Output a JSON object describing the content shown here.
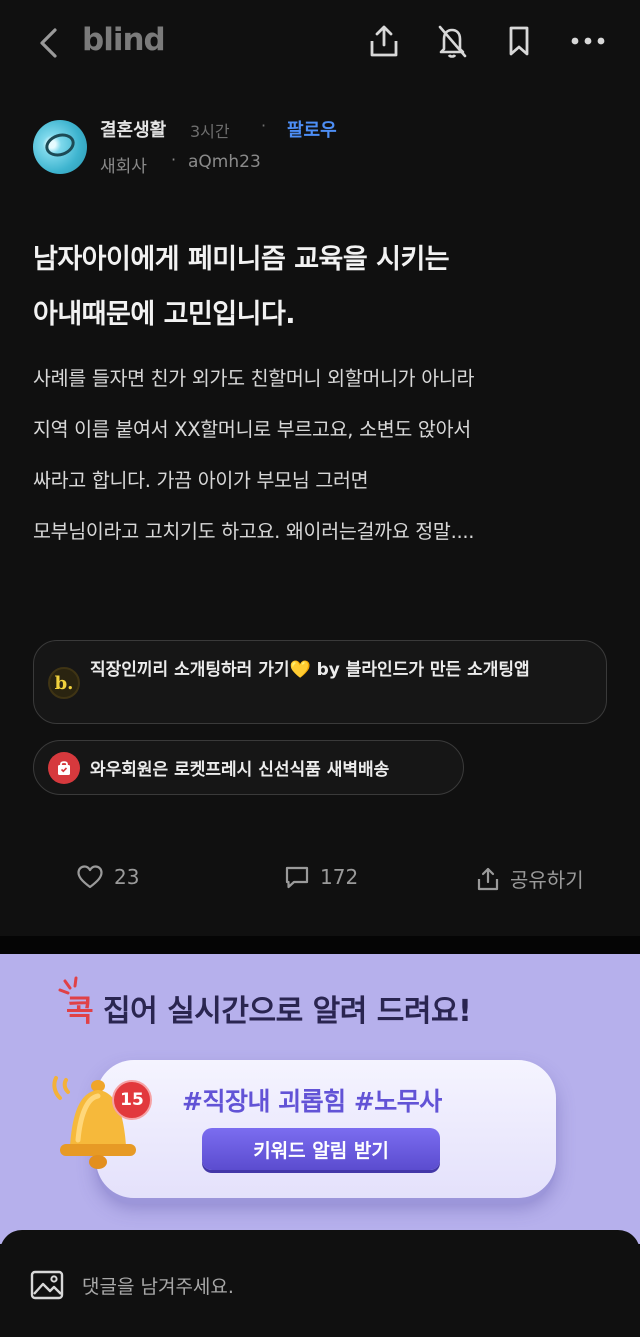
{
  "header": {
    "logo": "blind",
    "icons": [
      "back-icon",
      "share-icon",
      "notification-off-icon",
      "bookmark-icon",
      "more-icon"
    ]
  },
  "author": {
    "name": "결혼생활",
    "time": "3시간",
    "separator": "·",
    "follow": "팔로우",
    "company": "새회사",
    "handle": "aQmh23"
  },
  "post": {
    "title_lines": [
      "남자아이에게 페미니즘 교육을 시키는",
      "아내때문에 고민입니다."
    ],
    "body_lines": [
      "사례를 들자면 친가 외가도 친할머니 외할머니가 아니라",
      "지역 이름 붙여서 XX할머니로 부르고요, 소변도 앉아서",
      "싸라고 합니다. 가끔 아이가 부모님 그러면",
      "모부님이라고 고치기도 하고요. 왜이러는걸까요 정말...."
    ]
  },
  "ads": {
    "chip1": {
      "icon_letter": "b.",
      "text": "직장인끼리 소개팅하러 가기💛 by 블라인드가 만든 소개팅앱"
    },
    "chip2": {
      "text": "와우회원은 로켓프레시 신선식품 새벽배송"
    }
  },
  "actions": {
    "likes": "23",
    "comments": "172",
    "share": "공유하기"
  },
  "banner": {
    "headline_accent": "콕",
    "headline_rest": " 집어 실시간으로 알려 드려요!",
    "tags": "#직장내 괴롭힘  #노무사",
    "badge": "15",
    "button": "키워드 알림 받기"
  },
  "comment": {
    "placeholder": "댓글을 남겨주세요."
  }
}
